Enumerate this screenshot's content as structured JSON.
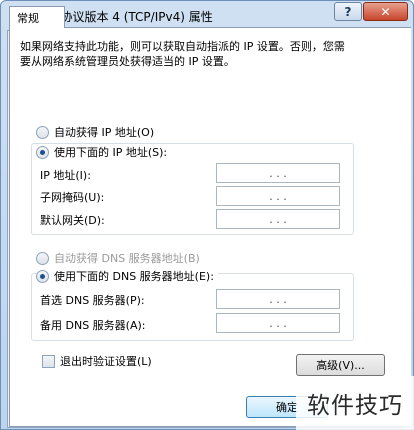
{
  "window": {
    "title": "Internet 协议版本 4 (TCP/IPv4) 属性",
    "help_label": "?",
    "close_label": "✕"
  },
  "tabs": [
    {
      "label": "常规"
    }
  ],
  "description": "如果网络支持此功能，则可以获取自动指派的 IP 设置。否则，您需要从网络系统管理员处获得适当的 IP 设置。",
  "ip_section": {
    "auto_label": "自动获得 IP 地址(O)",
    "manual_label": "使用下面的 IP 地址(S):",
    "selected": "manual",
    "fields": [
      {
        "label": "IP 地址(I):",
        "value": ".   .   ."
      },
      {
        "label": "子网掩码(U):",
        "value": ".   .   ."
      },
      {
        "label": "默认网关(D):",
        "value": ".   .   ."
      }
    ]
  },
  "dns_section": {
    "auto_label": "自动获得 DNS 服务器地址(B)",
    "manual_label": "使用下面的 DNS 服务器地址(E):",
    "selected": "manual",
    "auto_disabled": true,
    "fields": [
      {
        "label": "首选 DNS 服务器(P):",
        "value": ".   .   ."
      },
      {
        "label": "备用 DNS 服务器(A):",
        "value": ".   .   ."
      }
    ]
  },
  "validate_checkbox": {
    "label": "退出时验证设置(L)",
    "checked": false
  },
  "buttons": {
    "advanced": "高级(V)...",
    "ok": "确定"
  },
  "watermark": "软件技巧"
}
